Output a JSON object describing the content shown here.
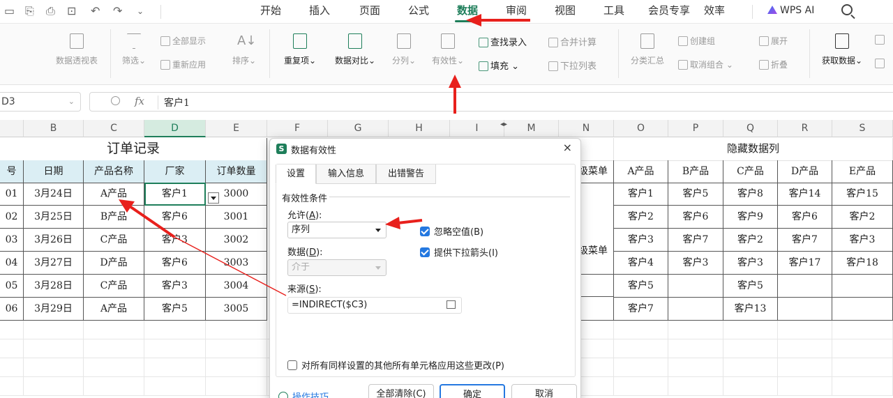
{
  "menubar": {
    "tabs": [
      "开始",
      "插入",
      "页面",
      "公式",
      "数据",
      "审阅",
      "视图",
      "工具",
      "会员专享",
      "效率"
    ],
    "active_tab": "数据",
    "wps_ai": "WPS AI"
  },
  "ribbon": {
    "pivot": "数据透视表",
    "filter": "筛选",
    "show_all": "全部显示",
    "reapply": "重新应用",
    "sort": "排序",
    "duplicates": "重复项",
    "compare": "数据对比",
    "split": "分列",
    "validity": "有效性",
    "lookup_entry": "查找录入",
    "fill": "填充",
    "merge_calc": "合并计算",
    "dropdown_list": "下拉列表",
    "subtotal": "分类汇总",
    "create_group": "创建组",
    "ungroup": "取消组合",
    "expand": "展开",
    "collapse": "折叠",
    "get_data": "获取数据"
  },
  "formula_bar": {
    "name_box": "D3",
    "fx": "fx",
    "value": "客户1"
  },
  "sheet": {
    "columns": [
      "B",
      "C",
      "D",
      "E",
      "F",
      "G",
      "H",
      "I",
      "M",
      "N",
      "O",
      "P",
      "Q",
      "R",
      "S"
    ],
    "selected_column": "D",
    "order_title": "订单记录",
    "hidden_title": "隐藏数据列",
    "headers": [
      "号",
      "日期",
      "产品名称",
      "厂家",
      "订单数量"
    ],
    "rows": [
      [
        "01",
        "3月24日",
        "A产品",
        "客户1",
        "3000"
      ],
      [
        "02",
        "3月25日",
        "B产品",
        "客户6",
        "3001"
      ],
      [
        "03",
        "3月26日",
        "C产品",
        "客户3",
        "3002"
      ],
      [
        "04",
        "3月27日",
        "D产品",
        "客户6",
        "3003"
      ],
      [
        "05",
        "3月28日",
        "C产品",
        "客户3",
        "3004"
      ],
      [
        "06",
        "3月29日",
        "A产品",
        "客户5",
        "3005"
      ]
    ],
    "n_header_partial": "级菜单",
    "n_partial": "级菜单",
    "hidden_headers": [
      "A产品",
      "B产品",
      "C产品",
      "D产品",
      "E产品"
    ],
    "hidden_rows": [
      [
        "客户1",
        "客户5",
        "客户8",
        "客户14",
        "客户15"
      ],
      [
        "客户2",
        "客户6",
        "客户9",
        "客户6",
        "客户2"
      ],
      [
        "客户3",
        "客户7",
        "客户2",
        "客户7",
        "客户3"
      ],
      [
        "客户4",
        "客户3",
        "客户3",
        "客户17",
        "客户18"
      ],
      [
        "客户5",
        "",
        "客户5",
        "",
        ""
      ],
      [
        "客户7",
        "",
        "客户13",
        "",
        ""
      ]
    ]
  },
  "dialog": {
    "title": "数据有效性",
    "logo": "S",
    "close": "×",
    "tabs": [
      "设置",
      "输入信息",
      "出错警告"
    ],
    "group": "有效性条件",
    "allow_label": "允许(",
    "allow_key": "A",
    "allow_tail": "):",
    "allow_value": "序列",
    "data_label": "数据(",
    "data_key": "D",
    "data_tail": "):",
    "data_value": "介于",
    "source_label": "来源(",
    "source_key": "S",
    "source_tail": "):",
    "source_value": "=INDIRECT($C3)",
    "ignore_blank": "忽略空值(B)",
    "show_dropdown": "提供下拉箭头(I)",
    "apply_all": "对所有同样设置的其他所有单元格应用这些更改(P)",
    "tips": "操作技巧",
    "clear_all": "全部清除(C)",
    "ok": "确定",
    "cancel": "取消"
  },
  "colors": {
    "accent": "#1e7e5a",
    "header_fill": "#dbeef4",
    "arrow": "#e8201c",
    "checkbox": "#2478e0"
  }
}
